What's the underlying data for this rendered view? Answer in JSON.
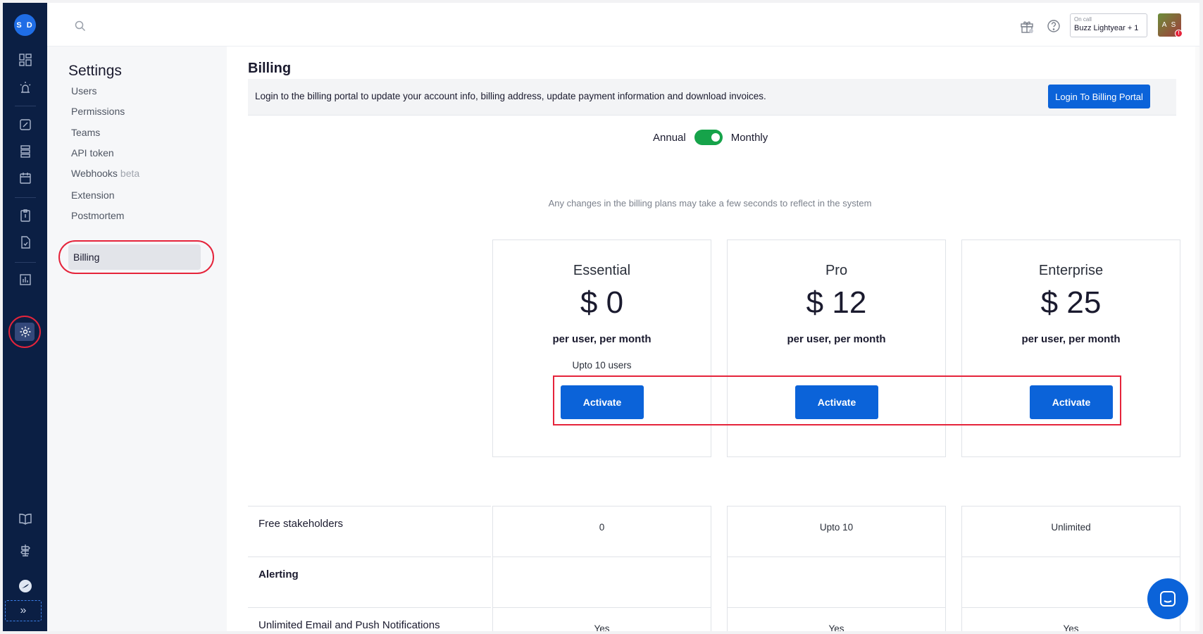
{
  "rail": {
    "user_initials": "S D",
    "icons": [
      "dashboard-icon",
      "incident-icon",
      "edit-icon",
      "services-icon",
      "calendar-icon",
      "clipboard-icon",
      "postmortem-icon",
      "analytics-icon",
      "settings-icon",
      "book-icon",
      "signpost-icon",
      "brand-icon"
    ],
    "expand_glyph": "»"
  },
  "topbar": {
    "oncall_label": "On call",
    "oncall_who": "Buzz Lightyear + 1",
    "user_initials": "A S",
    "badge": "!"
  },
  "settings": {
    "title": "Settings",
    "items": [
      {
        "label": "Users"
      },
      {
        "label": "Permissions"
      },
      {
        "label": "Teams"
      },
      {
        "label": "API token"
      },
      {
        "label": "Webhooks",
        "badge": "beta"
      },
      {
        "label": "Extension"
      },
      {
        "label": "Postmortem"
      },
      {
        "label": "Billing"
      }
    ]
  },
  "billing": {
    "title": "Billing",
    "banner_text": "Login to the billing portal to update your account info, billing address, update payment information and download invoices.",
    "portal_button": "Login To Billing Portal",
    "toggle_left": "Annual",
    "toggle_right": "Monthly",
    "notice": "Any changes in the billing plans may take a few seconds to reflect in the system",
    "plans": [
      {
        "name": "Essential",
        "price": "$ 0",
        "unit": "per user, per month",
        "note": "Upto 10 users",
        "button": "Activate"
      },
      {
        "name": "Pro",
        "price": "$ 12",
        "unit": "per user, per month",
        "note": "",
        "button": "Activate"
      },
      {
        "name": "Enterprise",
        "price": "$ 25",
        "unit": "per user, per month",
        "note": "",
        "button": "Activate"
      }
    ],
    "features": [
      {
        "label": "Free stakeholders",
        "values": [
          "0",
          "Upto 10",
          "Unlimited"
        ],
        "section": false
      },
      {
        "label": "Alerting",
        "values": [
          "",
          "",
          ""
        ],
        "section": true
      },
      {
        "label": "Unlimited Email and Push Notifications",
        "values": [
          "Yes",
          "Yes",
          "Yes"
        ],
        "section": false
      }
    ]
  }
}
